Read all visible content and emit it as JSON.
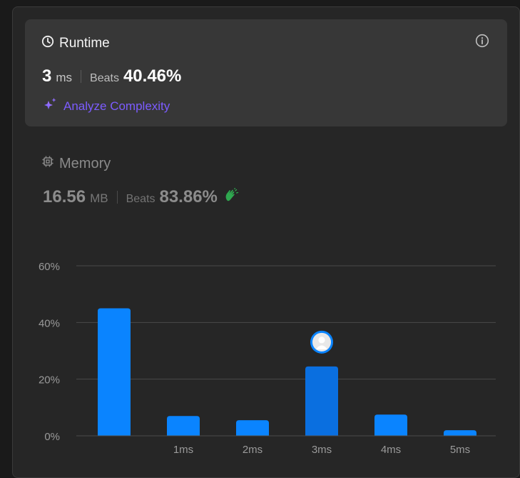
{
  "runtime": {
    "title": "Runtime",
    "value": "3",
    "unit": "ms",
    "beats_label": "Beats",
    "beats_value": "40.46%",
    "analyze_label": "Analyze Complexity",
    "title_icon": "clock-icon",
    "info_icon": "info-icon",
    "analyze_icon": "sparkle-icon"
  },
  "memory": {
    "title": "Memory",
    "value": "16.56",
    "unit": "MB",
    "beats_label": "Beats",
    "beats_value": "83.86%",
    "title_icon": "chip-icon",
    "badge_icon": "clapping-hands-icon"
  },
  "colors": {
    "accent_bar": "#0a84ff",
    "highlight_bar": "#0a6fe0",
    "analyze": "#7c5cff",
    "memory_badge": "#2fa84f"
  },
  "chart_data": {
    "type": "bar",
    "categories": [
      "",
      "1ms",
      "2ms",
      "3ms",
      "4ms",
      "5ms"
    ],
    "values": [
      45,
      7,
      5.5,
      24.5,
      7.5,
      2
    ],
    "y_tick_labels": [
      "0%",
      "20%",
      "40%",
      "60%"
    ],
    "y_ticks": [
      0,
      20,
      40,
      60
    ],
    "ylim": [
      0,
      60
    ],
    "grid": true,
    "highlight_category": "3ms",
    "highlight_marker": "avatar-icon"
  }
}
